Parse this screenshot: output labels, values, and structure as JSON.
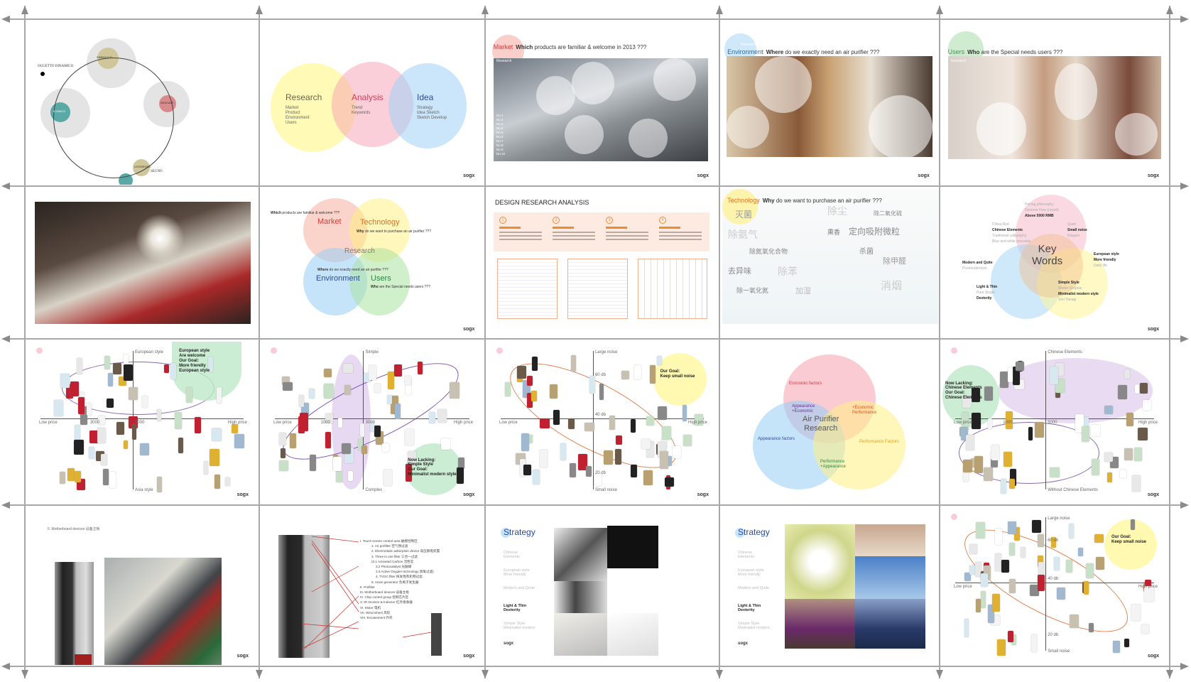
{
  "logo": "sogx",
  "colors": {
    "grid": "#a0a0a0",
    "yellow": "#fff59a",
    "pink": "#f7a9b8",
    "blue": "#a9d8f5",
    "green": "#bfe8c8",
    "purple": "#dcc3e8",
    "orange": "#f19a3e"
  },
  "s1": {
    "label_dynamic": "OGGETTO DINAMICO",
    "label_sign": "SEGNO",
    "nodes": [
      "SIMBOLICO",
      "ICONICO",
      "INDICALE",
      "LEGISEGNO"
    ]
  },
  "s2": {
    "research": "Research",
    "research_items": "Market\nProduct\nEnvironment\nUsers",
    "analysis": "Analysis",
    "analysis_items": "Trend\nKeywords",
    "idea": "Idea",
    "idea_items": "Strategy\nIdea Sketch\nSketch Develop"
  },
  "s3": {
    "key": "Market",
    "q_bold": "Which",
    "q": "products are familiar & welcome in 2013 ???",
    "sub": "Research",
    "ranks": [
      "No.1",
      "No.2",
      "No.3",
      "No.4",
      "No.5",
      "No.6",
      "No.7",
      "No.8",
      "No.9",
      "No.10"
    ]
  },
  "s4": {
    "key": "Environment",
    "q_bold": "Where",
    "q": "do we exactly need an air purifier ???",
    "sub": "Research"
  },
  "s5": {
    "key": "Users",
    "q_bold": "Who",
    "q": "are the Special needs users ???",
    "sub": "Research"
  },
  "s7": {
    "market": "Market",
    "market_q_bold": "Which",
    "market_q": "products are familiar & welcome ???",
    "technology": "Technology",
    "tech_q_bold": "Why",
    "tech_q": "do we want to purchase an air purifier ???",
    "research": "Research",
    "env_q_bold": "Where",
    "env_q": "do we exactly need an air purifier ???",
    "environment": "Environment",
    "users": "Users",
    "users_q_bold": "Who",
    "users_q": "are the Special needs users ???"
  },
  "s8": {
    "title": "DESIGN RESEARCH ANALYSIS",
    "steps": [
      "1",
      "2",
      "3",
      "4"
    ]
  },
  "s9": {
    "key": "Technology",
    "q_bold": "Why",
    "q": "do we want to purchase an air purifier ???",
    "words": [
      "灭菌",
      "除尘",
      "除二氧化硫",
      "除氨气",
      "熏香",
      "定向吸附微粒",
      "除氮氧化合物",
      "杀菌",
      "除甲醛",
      "去异味",
      "除苯",
      "除一氧化氮",
      "加湿",
      "消烟"
    ]
  },
  "s10": {
    "center": "Key\nWords",
    "top": [
      "Pricing philosophy",
      "Deserve How it worth",
      "Above 5000 RMB"
    ],
    "left": [
      "China Red",
      "Chinese Elements",
      "Traditional calligraphy",
      "Blue and white porcelain"
    ],
    "right": [
      "Quiet",
      "Small noise",
      "Elegant"
    ],
    "right2": [
      "European style",
      "More friendly",
      "Daily life"
    ],
    "midleft": [
      "Modern and Quite",
      "Postmodernism"
    ],
    "bottomleft": [
      "Light & Thin",
      "Pure Single",
      "Dexterity"
    ],
    "bottomright": [
      "Simple Style",
      "Walter Gropius",
      "Minimalist modern style",
      "Sori Yanagi"
    ]
  },
  "s11": {
    "top": "European style",
    "bottom": "Asia style",
    "left": "Low price",
    "right": "High price",
    "ticks": [
      "3000",
      "5000"
    ],
    "note": "European style\nAre welcome\nOur Goal:\nMore friendly\nEuropean style"
  },
  "s12": {
    "top": "Simple",
    "bottom": "Complex",
    "left": "Low price",
    "right": "High price",
    "ticks": [
      "1000",
      "3000"
    ],
    "note": "Now Lacking:\nSimple Style\nOur Goal:\nMinimalist modern style"
  },
  "s13": {
    "top": "Large noise",
    "bottom": "Small noise",
    "left": "Low price",
    "right": "High price",
    "db": [
      "60 db",
      "40 db",
      "20 db"
    ],
    "note": "Our Goal:\nKeep small noise"
  },
  "s14": {
    "center": "Air Purifier\nResearch",
    "economic": "Economic factors",
    "appearance": "Appearance factors",
    "performance": "Performance Factors",
    "app_eco": "Appearance\n+Economic",
    "eco_perf": "+Economic\nPerformance",
    "perf_app": "Performance\n+Appearance"
  },
  "s15": {
    "top": "Chinese Elements",
    "bottom": "Without Chinese Elements",
    "left": "Low price",
    "right": "High price",
    "ticks": [
      "1000",
      "5000"
    ],
    "note": "Now Lacking:\nChinese Elements\nOur Goal:\nChinese Elements"
  },
  "s16": {
    "caption": "II. Motherboard devices 设备主板"
  },
  "s17": {
    "parts": [
      "I. Touch screen control area 触摸控制区",
      "1. Air prefilter 空气预过滤",
      "2. Electrostatic adsorption device 高压静电装置",
      "3. Three in one filter 三合一过滤",
      "(3.1 Activated Carbon 活性炭",
      "3.2 Photocatalyst 光触媒",
      "3.3 Active Oxygen technology 臭氧过滤)",
      "4. TVOC filter 挥发性有机物过滤",
      "5. Anion generator 负离子发生器",
      "II. Prefilter",
      "III. Motherboard devices 设备主板",
      "IV. Chip control group 控制芯片区",
      "V. IR receiver & Inductor 红外接收器",
      "VI. Motor 电机",
      "VII. Wind wheel 风轮",
      "VIII. Encasement 外壳"
    ]
  },
  "strategy": {
    "title": "Strategy",
    "items": [
      "Chinese\nElements",
      "European style\nMore friendly",
      "Modern and Quite",
      "Light & Thin\nDexterity",
      "Simple Style\nMinimalist modern"
    ],
    "active_index": 3
  },
  "s20": {
    "top": "Large noise",
    "bottom": "Small noise",
    "left": "Low price",
    "right": "High price",
    "db": [
      "60 db",
      "40 db",
      "20 db"
    ],
    "note": "Our Goal:\nKeep small noise"
  }
}
